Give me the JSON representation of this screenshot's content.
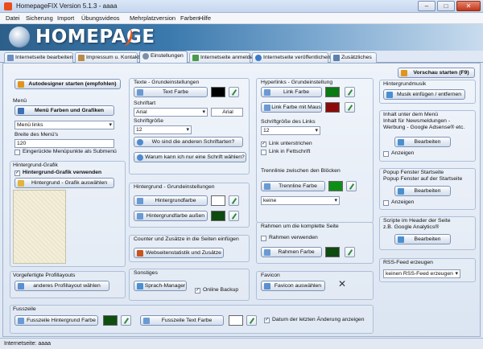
{
  "window": {
    "title": "HomepageFIX Version 5.1.3 - aaaa",
    "minimize": "–",
    "maximize": "□",
    "close": "✕"
  },
  "menu": [
    "Datei",
    "Sicherung",
    "Import",
    "Übungsvideos",
    "Mehrplatzversion",
    "Farben",
    "Hilfe"
  ],
  "banner": {
    "logo": "HOMEPAGE"
  },
  "tabs": [
    {
      "label": "Internetseite bearbeiten"
    },
    {
      "label": "Impressum u. Kontakt"
    },
    {
      "label": "Einstellungen"
    },
    {
      "label": "Internetseite anmelden"
    },
    {
      "label": "Internetseite veröffentlichen"
    },
    {
      "label": "Zusätzliches"
    }
  ],
  "col1": {
    "autodesigner": "Autodesigner starten (empfohlen)",
    "menu_title": "Menü",
    "menu_colors_btn": "Menü Farben und Grafiken",
    "menu_position": "Menü links",
    "menu_width_label": "Breite des Menü's",
    "menu_width_value": "120",
    "menu_indent_label": "Eingerückte Menüpunkte als Submenü",
    "bg_title": "Hintergrund-Grafik",
    "bg_use_label": "Hintergrund-Grafik verwenden",
    "bg_choose_btn": "Hintergrund - Grafik auswählen",
    "layouts_title": "Vorgefertigte Profillayouts",
    "layouts_btn": "anderes Profillayout wählen"
  },
  "col2": {
    "text_title": "Texte - Grundeinstellungen",
    "text_color_btn": "Text Farbe",
    "font_label": "Schriftart",
    "font_value": "Arial",
    "font_preview": "Arial",
    "size_label": "Schriftgröße",
    "size_value": "12",
    "other_fonts_btn": "Wo sind die anderen Schriftarten?",
    "why_one_font_btn": "Warum kann ich nur eine Schrift wählen?",
    "bg_title": "Hintergrund - Grundeinstellungen",
    "bg_color_btn": "Hintergrundfarbe",
    "bg_outer_btn": "Hintergrundfarbe außen",
    "counter_title": "Counter und Zusätze in die Seiten einfügen",
    "stats_btn": "Webseitenstatistik und Zusätze",
    "misc_title": "Sonstiges",
    "lang_btn": "Sprach-Manager",
    "online_backup_label": "Online Backup"
  },
  "col3": {
    "links_title": "Hyperlinks - Grundeinstellung",
    "link_color_btn": "Link Farbe",
    "link_hover_btn": "Link Farbe mit Maus",
    "link_size_label": "Schriftgröße des Links",
    "link_size_value": "12",
    "underline_label": "Link unterstrichen",
    "bold_label": "Link in Fettschrift",
    "sep_title": "Trennlinie zwischen den Blöcken",
    "sep_btn": "Trennline Farbe",
    "sep_value": "keine",
    "frame_title": "Rahmen um die komplette Seite",
    "frame_use_label": "Rahmen verwenden",
    "frame_btn": "Rahmen Farbe",
    "favicon_title": "Favicon",
    "favicon_btn": "Favicon auswählen"
  },
  "col4": {
    "preview_btn": "Vorschau starten (F9)",
    "music_title": "Hintergrundmusik",
    "music_btn": "Musik einfügen / entfernen",
    "menu_content_title": "Inhalt unter dem Menü",
    "menu_content_desc": "Inhalt für Newsmeldungen - Werbung - Google Adsense® etc.",
    "edit_btn_1": "Bearbeiten",
    "show_label_1": "Anzeigen",
    "popup_title": "Popup Fenster Startseite",
    "popup_desc": "Popup Fenster auf der Startseite",
    "edit_btn_2": "Bearbeiten",
    "show_label_2": "Anzeigen",
    "scripts_title": "Scripte im Header der Seite",
    "scripts_desc": "z.B. Google Analytics®",
    "edit_btn_3": "Bearbeiten",
    "rss_title": "RSS-Feed erzeugen",
    "rss_value": "keinen RSS-Feed erzeugen"
  },
  "footer": {
    "title": "Fusszeile",
    "bg_btn": "Fusszeile Hintergrund Farbe",
    "text_btn": "Fusszeile Text Farbe",
    "date_label": "Datum der letzten Änderung anzeigen"
  },
  "status": {
    "text": "Internetseite: aaaa"
  },
  "colors": {
    "black": "#000000",
    "white": "#ffffff",
    "green": "#0a7a12",
    "darkred": "#8b0b0b",
    "darkgreen": "#0f4a0f",
    "sep_green": "#0d8f17",
    "footer_green": "#0e4d0f"
  }
}
